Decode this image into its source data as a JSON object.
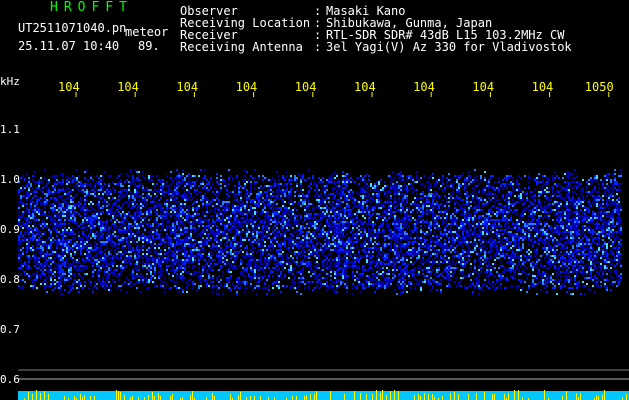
{
  "header": {
    "title": "HROFFT",
    "filename": "UT2511071040.pn",
    "meteor_label": "meteor",
    "datetime": "25.11.07 10:40",
    "count": "89.",
    "info": [
      {
        "label": "Observer",
        "value": "Masaki Kano"
      },
      {
        "label": "Receiving Location",
        "value": "Shibukawa, Gunma, Japan"
      },
      {
        "label": "Receiver",
        "value": "RTL-SDR SDR# 43dB L15 103.2MHz CW"
      },
      {
        "label": "Receiving Antenna",
        "value": "3el Yagi(V) Az 330 for Vladivostok"
      }
    ]
  },
  "chart_data": {
    "type": "heatmap",
    "x_ticks": [
      "104",
      "104",
      "104",
      "104",
      "104",
      "104",
      "104",
      "104",
      "104",
      "1050"
    ],
    "y_unit": "kHz",
    "y_ticks": [
      1.1,
      1.0,
      0.9,
      0.8,
      0.7,
      0.6
    ],
    "ylim": [
      0.6,
      1.1
    ],
    "echo_band": [
      0.785,
      1.01
    ],
    "colors": {
      "background": "#000000",
      "signal_low": "#0000cc",
      "signal_high": "#00ffff",
      "tick_text": "#ffff00",
      "bottom_bar": "#00c8ff",
      "bottom_spikes": "#ffff00"
    }
  }
}
